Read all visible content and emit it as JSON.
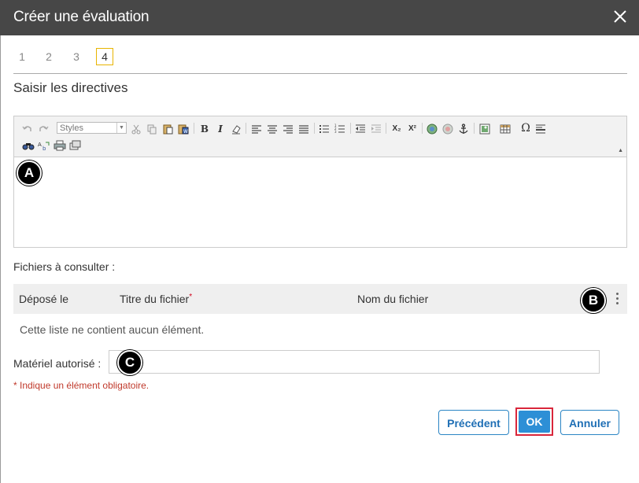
{
  "dialog": {
    "title": "Créer une évaluation"
  },
  "steps": [
    "1",
    "2",
    "3",
    "4"
  ],
  "active_step": "4",
  "section_title": "Saisir les directives",
  "editor": {
    "styles_placeholder": "Styles",
    "toolbar_icons": [
      "undo-icon",
      "redo-icon",
      "styles-select",
      "cut-icon",
      "copy-icon",
      "paste-icon",
      "paste-text-icon",
      "paste-word-icon",
      "bold-icon",
      "italic-icon",
      "remove-format-icon",
      "align-left-icon",
      "align-center-icon",
      "align-right-icon",
      "justify-icon",
      "numbered-list-icon",
      "bulleted-list-icon",
      "outdent-icon",
      "indent-icon",
      "subscript-icon",
      "superscript-icon",
      "link-icon",
      "unlink-icon",
      "anchor-icon",
      "image-icon",
      "table-icon",
      "special-char-icon",
      "horizontal-rule-icon",
      "find-icon",
      "replace-icon",
      "print-icon",
      "templates-icon"
    ],
    "bold_glyph": "B",
    "italic_glyph": "I",
    "omega_glyph": "Ω",
    "subscript_glyph": "X₂",
    "superscript_glyph": "X²",
    "content": ""
  },
  "annotations": {
    "a": "A",
    "b": "B",
    "c": "C"
  },
  "files": {
    "label": "Fichiers à consulter :",
    "columns": [
      "Déposé le",
      "Titre du fichier",
      "Nom du fichier"
    ],
    "required_marker": "*",
    "empty_text": "Cette liste ne contient aucun élément."
  },
  "materiel": {
    "label": "Matériel autorisé :",
    "value": ""
  },
  "required_note": "* Indique un élément obligatoire.",
  "buttons": {
    "previous": "Précédent",
    "ok": "OK",
    "cancel": "Annuler"
  },
  "colors": {
    "titlebar": "#474747",
    "accent": "#2d8fd6",
    "highlight": "#d9263b",
    "active_step_border": "#e8b400"
  }
}
